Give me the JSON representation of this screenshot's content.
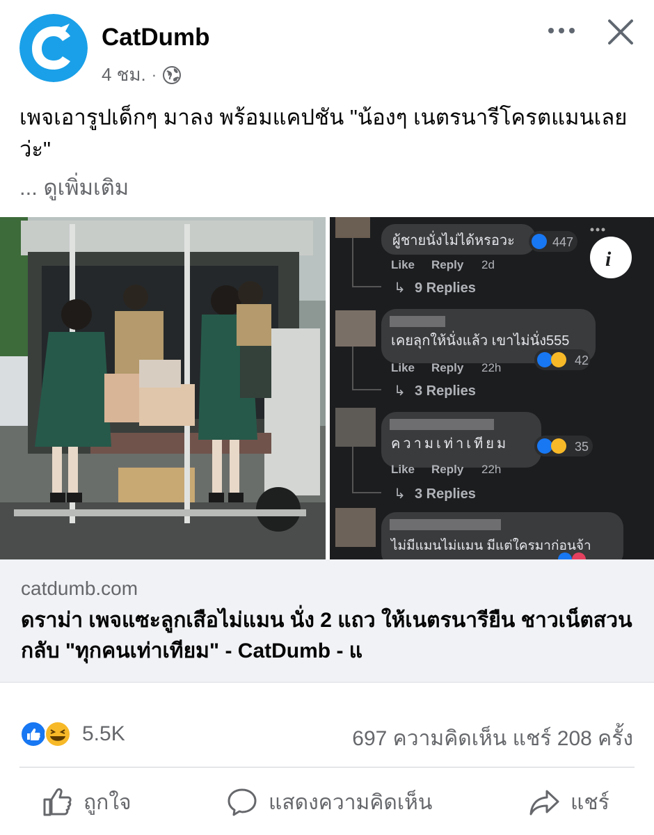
{
  "post": {
    "page_name": "CatDumb",
    "time": "4 ชม.",
    "separator": "·",
    "caption": "เพจเอารูปเด็กๆ มาลง พร้อมแคปชัน \"น้องๆ เนตรนารีโครตแมนเลยว่ะ\"",
    "see_more": "... ดูเพิ่มเติม",
    "icons": {
      "privacy": "globe-icon",
      "more": "more-options-icon",
      "close": "close-icon"
    }
  },
  "media": {
    "comments": [
      {
        "text": "ผู้ชายนั่งไม่ได้หรอวะ",
        "count": "447",
        "like": "Like",
        "reply": "Reply",
        "time": "2d",
        "replies": "9 Replies"
      },
      {
        "text": "เคยลุกให้นั่งแล้ว เขาไม่นั่ง555",
        "count": "42",
        "like": "Like",
        "reply": "Reply",
        "time": "22h",
        "replies": "3 Replies"
      },
      {
        "text": "ความเท่าเทียม",
        "count": "35",
        "like": "Like",
        "reply": "Reply",
        "time": "22h",
        "replies": "3 Replies"
      },
      {
        "text": "ไม่มีแมนไม่แมน มีแต่ใครมาก่อนจ้า"
      }
    ],
    "info_icon_label": "i"
  },
  "link": {
    "domain": "catdumb.com",
    "title": "ดราม่า เพจแซะลูกเสือไม่แมน นั่ง 2 แถว ให้เนตรนารียืน ชาวเน็ตสวนกลับ \"ทุกคนเท่าเทียม\" - CatDumb - แ"
  },
  "stats": {
    "reactions": "5.5K",
    "comments_shares": "697 ความคิดเห็น  แชร์ 208 ครั้ง"
  },
  "actions": {
    "like": "ถูกใจ",
    "comment": "แสดงความคิดเห็น",
    "share": "แชร์"
  },
  "colors": {
    "brand": "#1aa0e8",
    "like_blue": "#1877f2",
    "haha_yellow": "#f7b928"
  }
}
